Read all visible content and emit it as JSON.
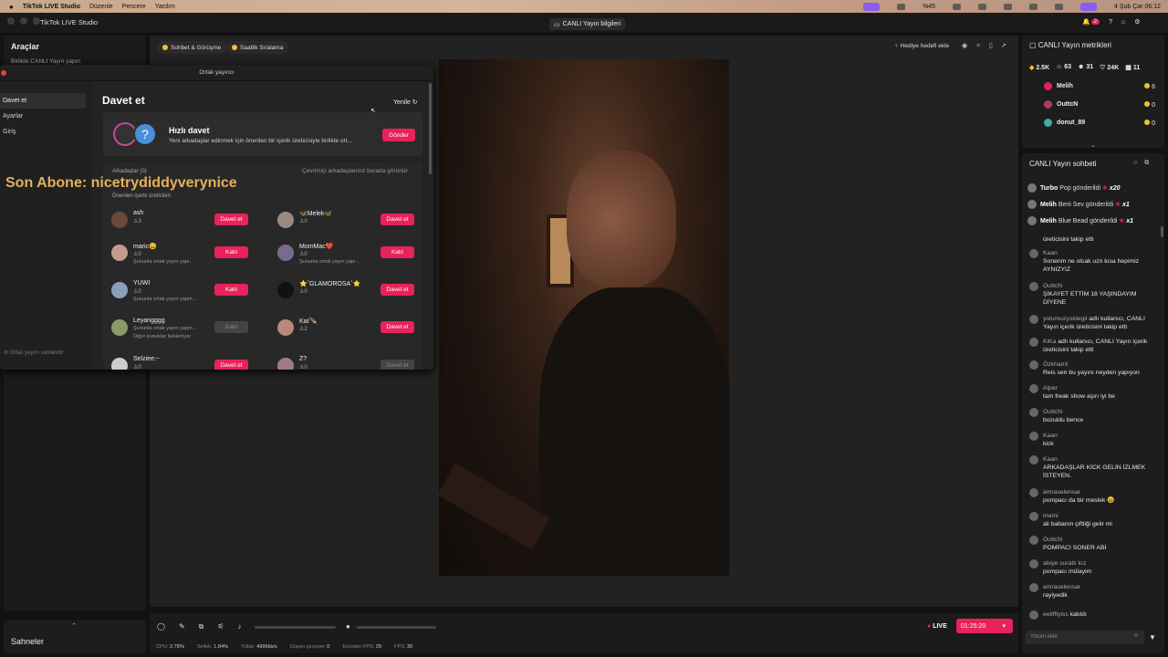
{
  "menubar": {
    "app": "TikTok LIVE Studio",
    "items": [
      "Düzenle",
      "Pencere",
      "Yardım"
    ],
    "clock": "4 Şub Çar  06:12",
    "battery": "%45"
  },
  "titlebar": {
    "app_title": "TikTok LIVE Studio",
    "center": "CANLI Yayın bilgileri",
    "notif_count": "2"
  },
  "left": {
    "tools_title": "Araçlar",
    "tools_sub": "Birlikte CANLI Yayın yapın",
    "scenes_title": "Sahneler"
  },
  "topchips": {
    "chat_battle": "Sohbet & Görüşme",
    "hourly_rank": "Saatlik Sıralama",
    "gift_goal": "Hediye hedefi ekle"
  },
  "dialog": {
    "title": "Ortak yayıncı",
    "nav": [
      "Davet et",
      "Ayarlar",
      "Giriş"
    ],
    "end_label": "Ortak yayını sonlandır",
    "heading": "Davet et",
    "refresh": "Yenile",
    "quick": {
      "title": "Hızlı davet",
      "desc": "Yeni arkadaşlar edinmek için önerilen bir içerik üreticisiyle birlikte ort...",
      "btn": "Gönder"
    },
    "friends_label": "Arkadaşlar (0)",
    "online_label": "Çevrimiçi arkadaşlarınız burada görünür",
    "suggested_label": "Önerilen içerik üreticileri",
    "users": [
      {
        "name": "ash",
        "count": "3",
        "sub": "",
        "btn": "Davet et",
        "color": "#6b4a3a"
      },
      {
        "name": "🦋Melek🦋",
        "count": "0",
        "sub": "",
        "btn": "Davet et",
        "color": "#9a8a80"
      },
      {
        "name": "maric😄",
        "count": "0",
        "sub": "Şununla ortak yayın yapı...",
        "btn": "Katıl",
        "color": "#c49a8a"
      },
      {
        "name": "MomMac❤️",
        "count": "0",
        "sub": "Şununla ortak yayın yapı...",
        "btn": "Katıl",
        "color": "#7a6a90"
      },
      {
        "name": "YUWI",
        "count": "0",
        "sub": "Şununla ortak yayın yapm...",
        "btn": "Katıl",
        "color": "#8aa0b8"
      },
      {
        "name": "⭐ˆGLAMOROSAˆ⭐",
        "count": "0",
        "sub": "",
        "btn": "Davet et",
        "color": "#111"
      },
      {
        "name": "Leyangggg",
        "count": "",
        "sub": "Şununla ortak yayın yapm...",
        "sub2": "Diğer konuklar bekleniyor",
        "btn": "Katıl",
        "disabled": true,
        "color": "#8a9a6a"
      },
      {
        "name": "Kat🪶",
        "count": "2",
        "sub": "",
        "btn": "Davet et",
        "color": "#b88a7a"
      },
      {
        "name": "Selziee:~",
        "count": "0",
        "sub": "",
        "btn": "Davet et",
        "color": "#ccc"
      },
      {
        "name": "Z?",
        "count": "0",
        "sub": "",
        "btn": "Davet et",
        "disabled": true,
        "color": "#a07a8a"
      }
    ]
  },
  "overlay_text": "Son Abone: nicetrydiddyverynice",
  "metrics": {
    "title": "CANLI Yayın metrikleri",
    "stats": [
      "2.5K",
      "63",
      "31",
      "24K",
      "11"
    ],
    "ranking": [
      {
        "name": "Melih",
        "val": "6"
      },
      {
        "name": "OuttcN",
        "val": "0"
      },
      {
        "name": "donut_89",
        "val": "0"
      }
    ]
  },
  "chat": {
    "title": "CANLI Yayın sohbeti",
    "input_placeholder": "Yorum ekle",
    "gifts": [
      {
        "user": "Turbo",
        "text": "Pop gönderildi",
        "mult": "x20"
      },
      {
        "user": "Melih",
        "text": "Beni Sev gönderildi",
        "mult": "x1"
      },
      {
        "user": "Melih",
        "text": "Blue Bead gönderildi",
        "mult": "x1"
      }
    ],
    "messages": [
      {
        "user": "",
        "text": "üreticisini takip etti"
      },
      {
        "user": "Kaan",
        "text": "Sonerim ne olcak uzn kısa hepimiz AYNIZYIZ"
      },
      {
        "user": "OuttcN",
        "text": "ŞİKAYET ETTİM 18 YAŞINDAYIM DİYENE"
      },
      {
        "user": "yolumuzyoldegil",
        "text": "adlı kullanıcı, CANLI Yayın içerik üreticisini takip etti"
      },
      {
        "user": "KiKa",
        "text": "adlı kullanıcı, CANLI Yayın içerik üreticisini takip etti"
      },
      {
        "user": "ÖzkhanX",
        "text": "Reis sen bu yayını neyden yapıyon"
      },
      {
        "user": "Alper",
        "text": "tam freak show aşırı iyi be"
      },
      {
        "user": "OuttcN",
        "text": "bozuldu bence"
      },
      {
        "user": "Kaan",
        "text": "kick"
      },
      {
        "user": "Kaan",
        "text": "ARKADAŞLAR KİCK GELİN İZLMEK İSTEYEN."
      },
      {
        "user": "amraselensar",
        "text": "pompacı da bir meslek 😆"
      },
      {
        "user": "mami",
        "text": "ali babanın çiftliği gelir mi"
      },
      {
        "user": "OuttcN",
        "text": "POMPACI SONER ABİ"
      },
      {
        "user": "abiye suratlı kız",
        "text": "pompacı mülayim"
      },
      {
        "user": "amraselensar",
        "text": "rayiyedik"
      },
      {
        "user": "eelifftyiss",
        "text": "katıldı"
      }
    ]
  },
  "bottombar": {
    "live_label": "LIVE",
    "timer": "01:25:20"
  },
  "statusbar": [
    {
      "k": "CPU:",
      "v": "2.78%"
    },
    {
      "k": "Sellek:",
      "v": "1.84%"
    },
    {
      "k": "Yükle:",
      "v": "4996kb/s"
    },
    {
      "k": "Düşen çerçeve:",
      "v": "0"
    },
    {
      "k": "Encoder FPS:",
      "v": "29"
    },
    {
      "k": "FPS:",
      "v": "30"
    }
  ]
}
